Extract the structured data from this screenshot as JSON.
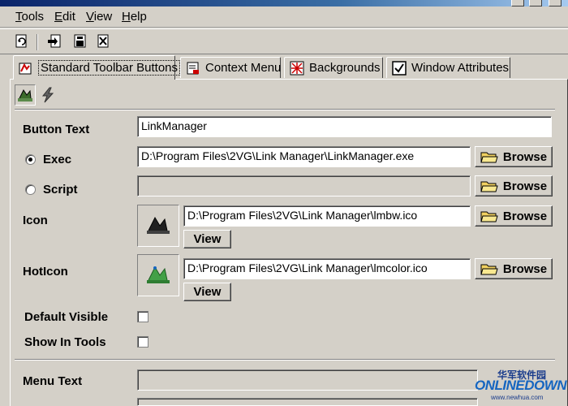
{
  "menu": {
    "items": [
      {
        "accel": "T",
        "rest": "ools"
      },
      {
        "accel": "E",
        "rest": "dit"
      },
      {
        "accel": "V",
        "rest": "iew"
      },
      {
        "accel": "H",
        "rest": "elp"
      }
    ]
  },
  "toolbar": {
    "icons": [
      "refresh-icon",
      "import-icon",
      "save-icon",
      "delete-icon"
    ]
  },
  "tabs": [
    {
      "label": "Standard Toolbar Buttons",
      "icon": "toolbar-button-icon",
      "active": true
    },
    {
      "label": "Context Menu",
      "icon": "context-menu-icon",
      "active": false
    },
    {
      "label": "Backgrounds",
      "icon": "backgrounds-icon",
      "active": false
    },
    {
      "label": "Window Attributes",
      "icon": "window-attributes-icon",
      "active": false
    }
  ],
  "form": {
    "button_text_label": "Button Text",
    "button_text_value": "LinkManager",
    "exec_label": "Exec",
    "exec_value": "D:\\Program Files\\2VG\\Link Manager\\LinkManager.exe",
    "exec_selected": true,
    "script_label": "Script",
    "script_value": "",
    "icon_label": "Icon",
    "icon_value": "D:\\Program Files\\2VG\\Link Manager\\lmbw.ico",
    "hoticon_label": "HotIcon",
    "hoticon_value": "D:\\Program Files\\2VG\\Link Manager\\lmcolor.ico",
    "browse_label": "Browse",
    "view_label": "View",
    "default_visible_label": "Default Visible",
    "default_visible_checked": false,
    "show_in_tools_label": "Show In Tools",
    "show_in_tools_checked": false,
    "menu_text_label": "Menu Text",
    "menu_text_value": ""
  },
  "watermark": {
    "cn": "华军软件园",
    "en": "ONLINEDOWN",
    "url": "www.newhua.com"
  },
  "colors": {
    "face": "#d4d0c8",
    "titlebar": "#0a246a",
    "watermark": "#1565c0"
  }
}
